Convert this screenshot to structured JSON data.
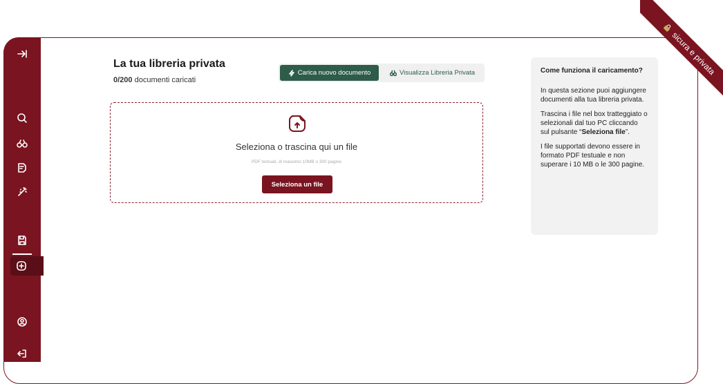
{
  "library": {
    "title": "La tua libreria privata",
    "count": "0/200",
    "count_suffix": " documenti caricati"
  },
  "tabs": {
    "upload_label": "Carica nuovo documento",
    "view_label": "Visualizza Libreria Privata"
  },
  "dropzone": {
    "title": "Seleziona o trascina qui un file",
    "hint": "PDF testuali, di massimo 10MB o 300 pagine",
    "button_label": "Seleziona un file"
  },
  "help": {
    "title": "Come funziona il caricamento?",
    "p1": "In questa sezione puoi aggiungere documenti alla tua libreria privata.",
    "p2_pre": "Trascina i file nel box tratteggiato o selezionali dal tuo PC cliccando sul pulsante “",
    "p2_bold": "Seleziona file",
    "p2_post": "”.",
    "p3": "I file supportati devono essere in formato PDF testuale e non superare i 10 MB o le 300 pagine."
  },
  "ribbon": {
    "label": "sicura e privata"
  },
  "sidebar": {
    "icons": [
      "expand-icon",
      "search-icon",
      "binoculars-icon",
      "document-icon",
      "magic-wand-icon",
      "save-icon",
      "add-icon",
      "user-icon",
      "logout-icon"
    ]
  },
  "colors": {
    "brand": "#7a1420",
    "accent": "#2e5c4a",
    "panel": "#f2f2f2"
  }
}
